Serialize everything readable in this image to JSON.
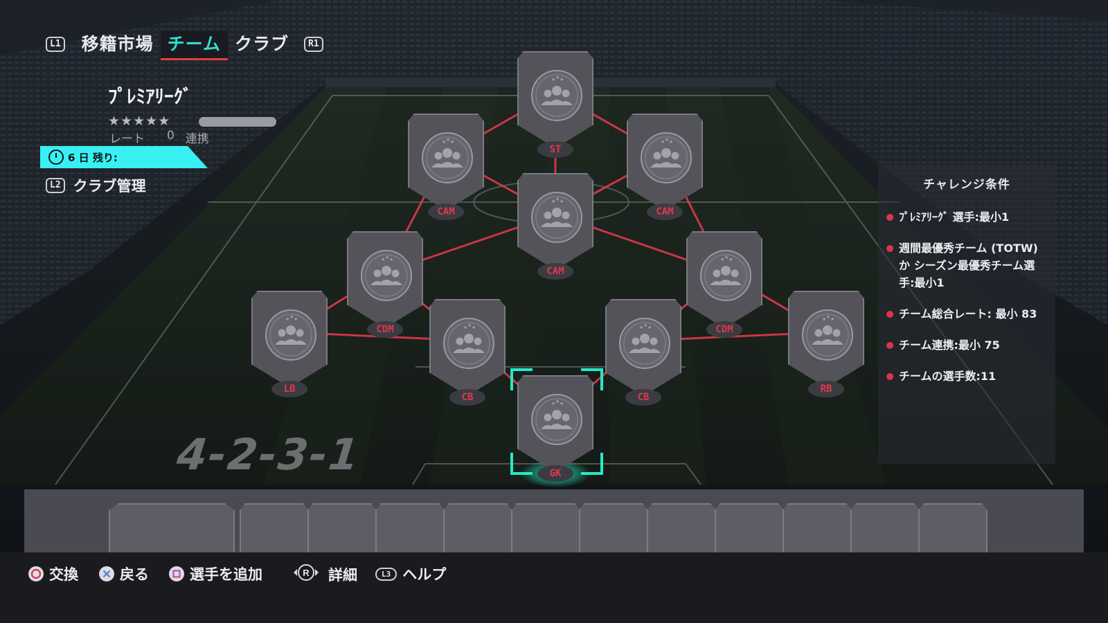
{
  "nav": {
    "left_button": "L1",
    "right_button": "R1",
    "tabs": [
      {
        "label": "移籍市場",
        "active": false
      },
      {
        "label": "チーム",
        "active": true
      },
      {
        "label": "クラブ",
        "active": false
      }
    ]
  },
  "squad": {
    "league_name": "ﾌﾟﾚﾐｱﾘｰｸﾞ",
    "stars": "★★★★★",
    "rating_label": "レート",
    "rating_value": "0",
    "chemistry_label": "連携",
    "timer_text": "6 日 残り:",
    "club_button": "L2",
    "club_label": "クラブ管理"
  },
  "formation": "4-2-3-1",
  "players": [
    {
      "id": "st",
      "position": "ST"
    },
    {
      "id": "cam-l",
      "position": "CAM"
    },
    {
      "id": "cam-r",
      "position": "CAM"
    },
    {
      "id": "cam-c",
      "position": "CAM"
    },
    {
      "id": "cdm-l",
      "position": "CDM"
    },
    {
      "id": "cdm-r",
      "position": "CDM"
    },
    {
      "id": "lb",
      "position": "LB"
    },
    {
      "id": "cb-l",
      "position": "CB"
    },
    {
      "id": "cb-r",
      "position": "CB"
    },
    {
      "id": "rb",
      "position": "RB"
    },
    {
      "id": "gk",
      "position": "GK",
      "selected": true
    }
  ],
  "challenge": {
    "title": "チャレンジ条件",
    "requirements": [
      "ﾌﾟﾚﾐｱﾘｰｸﾞ 選手:最小1",
      "週間最優秀チーム (TOTW) か シーズン最優秀チーム選手:最小1",
      "チーム総合レート: 最小 83",
      "チーム連携:最小 75",
      "チームの選手数:11"
    ]
  },
  "hints": [
    {
      "button": "circle-button",
      "label": "交換"
    },
    {
      "button": "cross-button",
      "label": "戻る"
    },
    {
      "button": "square-button",
      "label": "選手を追加"
    },
    {
      "button": "r-stick",
      "label": "詳細",
      "glyph": "R"
    },
    {
      "button": "l3-button",
      "label": "ヘルプ",
      "glyph": "L3"
    }
  ],
  "colors": {
    "accent_teal": "#2de0d0",
    "timer_bg": "#38f0f2",
    "link_red": "#e0384c",
    "position_red": "#e0384c",
    "selection": "#26e8c8"
  }
}
